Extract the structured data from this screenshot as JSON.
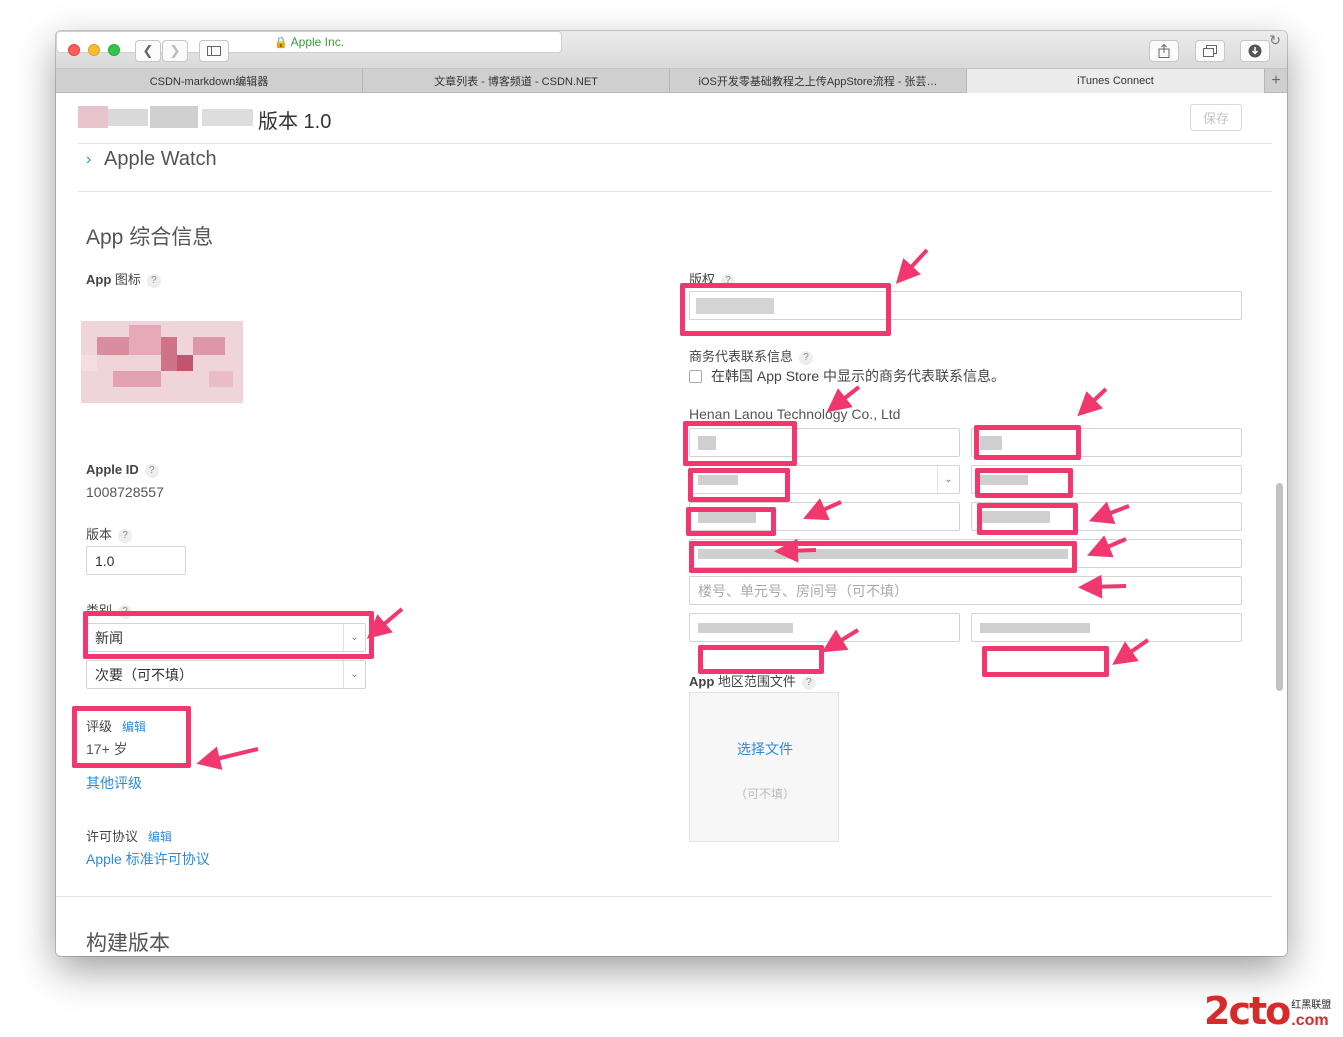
{
  "browser": {
    "url_label": "Apple Inc.",
    "tabs": [
      {
        "label": "CSDN-markdown编辑器"
      },
      {
        "label": "文章列表 - 博客频道 - CSDN.NET"
      },
      {
        "label": "iOS开发零基础教程之上传AppStore流程 - 张芸…"
      },
      {
        "label": "iTunes Connect"
      }
    ],
    "new_tab": "+"
  },
  "header": {
    "version_label": "版本 1.0",
    "save_label": "保存",
    "apple_watch_chevron": "›",
    "apple_watch_label": "Apple Watch"
  },
  "app_info": {
    "title": "App 综合信息",
    "icon_label_bold": "App",
    "icon_label_rest": " 图标",
    "apple_id_label_bold": "Apple ID",
    "apple_id_value": "1008728557",
    "version_label": "版本",
    "version_value": "1.0",
    "category_label": "类别",
    "category_primary": "新闻",
    "category_secondary": "次要（可不填）",
    "rating_label": "评级",
    "rating_edit": "编辑",
    "rating_value": "17+ 岁",
    "other_ratings": "其他评级",
    "license_label": "许可协议",
    "license_edit": "编辑",
    "license_link": "Apple 标准许可协议",
    "help": "?"
  },
  "right": {
    "copyright_label": "版权",
    "contact_label": "商务代表联系信息",
    "korea_checkbox_label": "在韩国 App Store 中显示的商务代表联系信息。",
    "company": "Henan Lanou Technology Co., Ltd",
    "address2_placeholder": "楼号、单元号、房间号（可不填）",
    "region_label_bold": "App",
    "region_label_rest": " 地区范围文件",
    "choose_file": "选择文件",
    "optional": "（可不填）"
  },
  "footer": {
    "build_title": "构建版本"
  },
  "watermark": {
    "brand": "2cto",
    "domain": ".com",
    "tag": "红黑联盟"
  },
  "colors": {
    "accent": "#2e8ad8",
    "annotation": "#f0386e",
    "lock": "#3c9a3c"
  }
}
